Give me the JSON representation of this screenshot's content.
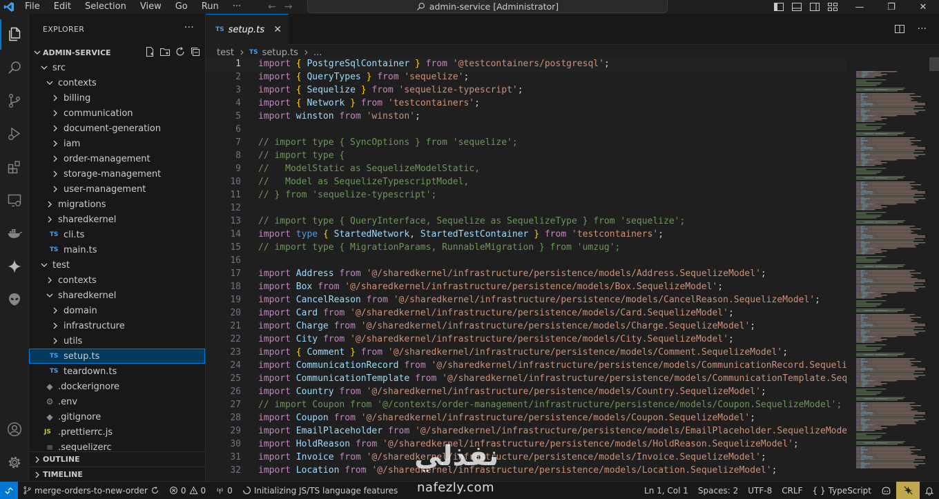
{
  "titlebar": {
    "menu": [
      "File",
      "Edit",
      "Selection",
      "View",
      "Go",
      "Run",
      "···"
    ],
    "command_center": "admin-service [Administrator]"
  },
  "explorer": {
    "title": "EXPLORER",
    "project": "ADMIN-SERVICE",
    "tree": [
      {
        "label": "src",
        "depth": 0,
        "kind": "folder-open"
      },
      {
        "label": "contexts",
        "depth": 1,
        "kind": "folder-open"
      },
      {
        "label": "billing",
        "depth": 2,
        "kind": "folder"
      },
      {
        "label": "communication",
        "depth": 2,
        "kind": "folder"
      },
      {
        "label": "document-generation",
        "depth": 2,
        "kind": "folder"
      },
      {
        "label": "iam",
        "depth": 2,
        "kind": "folder"
      },
      {
        "label": "order-management",
        "depth": 2,
        "kind": "folder"
      },
      {
        "label": "storage-management",
        "depth": 2,
        "kind": "folder"
      },
      {
        "label": "user-management",
        "depth": 2,
        "kind": "folder"
      },
      {
        "label": "migrations",
        "depth": 1,
        "kind": "folder"
      },
      {
        "label": "sharedkernel",
        "depth": 1,
        "kind": "folder"
      },
      {
        "label": "cli.ts",
        "depth": 1,
        "kind": "ts"
      },
      {
        "label": "main.ts",
        "depth": 1,
        "kind": "ts"
      },
      {
        "label": "test",
        "depth": 0,
        "kind": "folder-open"
      },
      {
        "label": "contexts",
        "depth": 1,
        "kind": "folder"
      },
      {
        "label": "sharedkernel",
        "depth": 1,
        "kind": "folder-open"
      },
      {
        "label": "domain",
        "depth": 2,
        "kind": "folder"
      },
      {
        "label": "infrastructure",
        "depth": 2,
        "kind": "folder"
      },
      {
        "label": "utils",
        "depth": 2,
        "kind": "folder"
      },
      {
        "label": "setup.ts",
        "depth": 1,
        "kind": "ts",
        "selected": true
      },
      {
        "label": "teardown.ts",
        "depth": 1,
        "kind": "ts"
      },
      {
        "label": ".dockerignore",
        "depth": 0,
        "kind": "docker"
      },
      {
        "label": ".env",
        "depth": 0,
        "kind": "gear"
      },
      {
        "label": ".gitignore",
        "depth": 0,
        "kind": "git"
      },
      {
        "label": ".prettierrc.js",
        "depth": 0,
        "kind": "js"
      },
      {
        "label": ".sequelizerc",
        "depth": 0,
        "kind": "lines"
      }
    ],
    "sections": [
      "OUTLINE",
      "TIMELINE"
    ]
  },
  "editor": {
    "tab": {
      "icon": "TS",
      "label": "setup.ts"
    },
    "breadcrumb": [
      "test",
      "setup.ts",
      "..."
    ],
    "lines": [
      [
        [
          "kw",
          "import"
        ],
        [
          "pu",
          " "
        ],
        [
          "br",
          "{"
        ],
        [
          "pu",
          " "
        ],
        [
          "id",
          "PostgreSqlContainer"
        ],
        [
          "pu",
          " "
        ],
        [
          "br",
          "}"
        ],
        [
          "pu",
          " "
        ],
        [
          "kw",
          "from"
        ],
        [
          "pu",
          " "
        ],
        [
          "str",
          "'@testcontainers/postgresql'"
        ],
        [
          "pu",
          ";"
        ]
      ],
      [
        [
          "kw",
          "import"
        ],
        [
          "pu",
          " "
        ],
        [
          "br",
          "{"
        ],
        [
          "pu",
          " "
        ],
        [
          "id",
          "QueryTypes"
        ],
        [
          "pu",
          " "
        ],
        [
          "br",
          "}"
        ],
        [
          "pu",
          " "
        ],
        [
          "kw",
          "from"
        ],
        [
          "pu",
          " "
        ],
        [
          "str",
          "'sequelize'"
        ],
        [
          "pu",
          ";"
        ]
      ],
      [
        [
          "kw",
          "import"
        ],
        [
          "pu",
          " "
        ],
        [
          "br",
          "{"
        ],
        [
          "pu",
          " "
        ],
        [
          "id",
          "Sequelize"
        ],
        [
          "pu",
          " "
        ],
        [
          "br",
          "}"
        ],
        [
          "pu",
          " "
        ],
        [
          "kw",
          "from"
        ],
        [
          "pu",
          " "
        ],
        [
          "str",
          "'sequelize-typescript'"
        ],
        [
          "pu",
          ";"
        ]
      ],
      [
        [
          "kw",
          "import"
        ],
        [
          "pu",
          " "
        ],
        [
          "br",
          "{"
        ],
        [
          "pu",
          " "
        ],
        [
          "id",
          "Network"
        ],
        [
          "pu",
          " "
        ],
        [
          "br",
          "}"
        ],
        [
          "pu",
          " "
        ],
        [
          "kw",
          "from"
        ],
        [
          "pu",
          " "
        ],
        [
          "str",
          "'testcontainers'"
        ],
        [
          "pu",
          ";"
        ]
      ],
      [
        [
          "kw",
          "import"
        ],
        [
          "pu",
          " "
        ],
        [
          "id",
          "winston"
        ],
        [
          "pu",
          " "
        ],
        [
          "kw",
          "from"
        ],
        [
          "pu",
          " "
        ],
        [
          "str",
          "'winston'"
        ],
        [
          "pu",
          ";"
        ]
      ],
      [],
      [
        [
          "cm",
          "// import type { SyncOptions } from 'sequelize';"
        ]
      ],
      [
        [
          "cm",
          "// import type {"
        ]
      ],
      [
        [
          "cm",
          "//   ModelStatic as SequelizeModelStatic,"
        ]
      ],
      [
        [
          "cm",
          "//   Model as SequelizeTypescriptModel,"
        ]
      ],
      [
        [
          "cm",
          "// } from 'sequelize-typescript';"
        ]
      ],
      [],
      [
        [
          "cm",
          "// import type { QueryInterface, Sequelize as SequelizeType } from 'sequelize';"
        ]
      ],
      [
        [
          "kw",
          "import"
        ],
        [
          "pu",
          " "
        ],
        [
          "kwb",
          "type"
        ],
        [
          "pu",
          " "
        ],
        [
          "br",
          "{"
        ],
        [
          "pu",
          " "
        ],
        [
          "id",
          "StartedNetwork"
        ],
        [
          "pu",
          ", "
        ],
        [
          "id",
          "StartedTestContainer"
        ],
        [
          "pu",
          " "
        ],
        [
          "br",
          "}"
        ],
        [
          "pu",
          " "
        ],
        [
          "kw",
          "from"
        ],
        [
          "pu",
          " "
        ],
        [
          "str",
          "'testcontainers'"
        ],
        [
          "pu",
          ";"
        ]
      ],
      [
        [
          "cm",
          "// import type { MigrationParams, RunnableMigration } from 'umzug';"
        ]
      ],
      [],
      [
        [
          "kw",
          "import"
        ],
        [
          "pu",
          " "
        ],
        [
          "id",
          "Address"
        ],
        [
          "pu",
          " "
        ],
        [
          "kw",
          "from"
        ],
        [
          "pu",
          " "
        ],
        [
          "str",
          "'@/sharedkernel/infrastructure/persistence/models/Address.SequelizeModel'"
        ],
        [
          "pu",
          ";"
        ]
      ],
      [
        [
          "kw",
          "import"
        ],
        [
          "pu",
          " "
        ],
        [
          "id",
          "Box"
        ],
        [
          "pu",
          " "
        ],
        [
          "kw",
          "from"
        ],
        [
          "pu",
          " "
        ],
        [
          "str",
          "'@/sharedkernel/infrastructure/persistence/models/Box.SequelizeModel'"
        ],
        [
          "pu",
          ";"
        ]
      ],
      [
        [
          "kw",
          "import"
        ],
        [
          "pu",
          " "
        ],
        [
          "id",
          "CancelReason"
        ],
        [
          "pu",
          " "
        ],
        [
          "kw",
          "from"
        ],
        [
          "pu",
          " "
        ],
        [
          "str",
          "'@/sharedkernel/infrastructure/persistence/models/CancelReason.SequelizeModel'"
        ],
        [
          "pu",
          ";"
        ]
      ],
      [
        [
          "kw",
          "import"
        ],
        [
          "pu",
          " "
        ],
        [
          "id",
          "Card"
        ],
        [
          "pu",
          " "
        ],
        [
          "kw",
          "from"
        ],
        [
          "pu",
          " "
        ],
        [
          "str",
          "'@/sharedkernel/infrastructure/persistence/models/Card.SequelizeModel'"
        ],
        [
          "pu",
          ";"
        ]
      ],
      [
        [
          "kw",
          "import"
        ],
        [
          "pu",
          " "
        ],
        [
          "id",
          "Charge"
        ],
        [
          "pu",
          " "
        ],
        [
          "kw",
          "from"
        ],
        [
          "pu",
          " "
        ],
        [
          "str",
          "'@/sharedkernel/infrastructure/persistence/models/Charge.SequelizeModel'"
        ],
        [
          "pu",
          ";"
        ]
      ],
      [
        [
          "kw",
          "import"
        ],
        [
          "pu",
          " "
        ],
        [
          "id",
          "City"
        ],
        [
          "pu",
          " "
        ],
        [
          "kw",
          "from"
        ],
        [
          "pu",
          " "
        ],
        [
          "str",
          "'@/sharedkernel/infrastructure/persistence/models/City.SequelizeModel'"
        ],
        [
          "pu",
          ";"
        ]
      ],
      [
        [
          "kw",
          "import"
        ],
        [
          "pu",
          " "
        ],
        [
          "br",
          "{"
        ],
        [
          "pu",
          " "
        ],
        [
          "id",
          "Comment"
        ],
        [
          "pu",
          " "
        ],
        [
          "br",
          "}"
        ],
        [
          "pu",
          " "
        ],
        [
          "kw",
          "from"
        ],
        [
          "pu",
          " "
        ],
        [
          "str",
          "'@/sharedkernel/infrastructure/persistence/models/Comment.SequelizeModel'"
        ],
        [
          "pu",
          ";"
        ]
      ],
      [
        [
          "kw",
          "import"
        ],
        [
          "pu",
          " "
        ],
        [
          "id",
          "CommunicationRecord"
        ],
        [
          "pu",
          " "
        ],
        [
          "kw",
          "from"
        ],
        [
          "pu",
          " "
        ],
        [
          "str",
          "'@/sharedkernel/infrastructure/persistence/models/CommunicationRecord.SequelizeModel'"
        ],
        [
          "pu",
          ";"
        ]
      ],
      [
        [
          "kw",
          "import"
        ],
        [
          "pu",
          " "
        ],
        [
          "id",
          "CommunicationTemplate"
        ],
        [
          "pu",
          " "
        ],
        [
          "kw",
          "from"
        ],
        [
          "pu",
          " "
        ],
        [
          "str",
          "'@/sharedkernel/infrastructure/persistence/models/CommunicationTemplate.SequelizeModel'"
        ],
        [
          "pu",
          ";"
        ]
      ],
      [
        [
          "kw",
          "import"
        ],
        [
          "pu",
          " "
        ],
        [
          "id",
          "Country"
        ],
        [
          "pu",
          " "
        ],
        [
          "kw",
          "from"
        ],
        [
          "pu",
          " "
        ],
        [
          "str",
          "'@/sharedkernel/infrastructure/persistence/models/Country.SequelizeModel'"
        ],
        [
          "pu",
          ";"
        ]
      ],
      [
        [
          "cm",
          "// import Coupon from '@/contexts/order-management/infrastructure/persistence/models/Coupon.SequelizeModel';"
        ]
      ],
      [
        [
          "kw",
          "import"
        ],
        [
          "pu",
          " "
        ],
        [
          "id",
          "Coupon"
        ],
        [
          "pu",
          " "
        ],
        [
          "kw",
          "from"
        ],
        [
          "pu",
          " "
        ],
        [
          "str",
          "'@/sharedkernel/infrastructure/persistence/models/Coupon.SequelizeModel'"
        ],
        [
          "pu",
          ";"
        ]
      ],
      [
        [
          "kw",
          "import"
        ],
        [
          "pu",
          " "
        ],
        [
          "id",
          "EmailPlaceholder"
        ],
        [
          "pu",
          " "
        ],
        [
          "kw",
          "from"
        ],
        [
          "pu",
          " "
        ],
        [
          "str",
          "'@/sharedkernel/infrastructure/persistence/models/EmailPlaceholder.SequelizeModel'"
        ],
        [
          "pu",
          ";"
        ]
      ],
      [
        [
          "kw",
          "import"
        ],
        [
          "pu",
          " "
        ],
        [
          "id",
          "HoldReason"
        ],
        [
          "pu",
          " "
        ],
        [
          "kw",
          "from"
        ],
        [
          "pu",
          " "
        ],
        [
          "str",
          "'@/sharedkernel/infrastructure/persistence/models/HoldReason.SequelizeModel'"
        ],
        [
          "pu",
          ";"
        ]
      ],
      [
        [
          "kw",
          "import"
        ],
        [
          "pu",
          " "
        ],
        [
          "id",
          "Invoice"
        ],
        [
          "pu",
          " "
        ],
        [
          "kw",
          "from"
        ],
        [
          "pu",
          " "
        ],
        [
          "str",
          "'@/sharedkernel/infrastructure/persistence/models/Invoice.SequelizeModel'"
        ],
        [
          "pu",
          ";"
        ]
      ],
      [
        [
          "kw",
          "import"
        ],
        [
          "pu",
          " "
        ],
        [
          "id",
          "Location"
        ],
        [
          "pu",
          " "
        ],
        [
          "kw",
          "from"
        ],
        [
          "pu",
          " "
        ],
        [
          "str",
          "'@/sharedkernel/infrastructure/persistence/models/Location.SequelizeModel'"
        ],
        [
          "pu",
          ";"
        ]
      ]
    ]
  },
  "statusbar": {
    "branch": "merge-orders-to-new-order",
    "errors": "0",
    "warnings": "0",
    "ports": "0",
    "task": "Initializing JS/TS language features",
    "cursor": "Ln 1, Col 1",
    "spaces": "Spaces: 2",
    "encoding": "UTF-8",
    "eol": "CRLF",
    "language_braces": "{ }",
    "language": "TypeScript"
  },
  "watermark": {
    "ar": "نفذلي",
    "en": "nafezly.com"
  }
}
